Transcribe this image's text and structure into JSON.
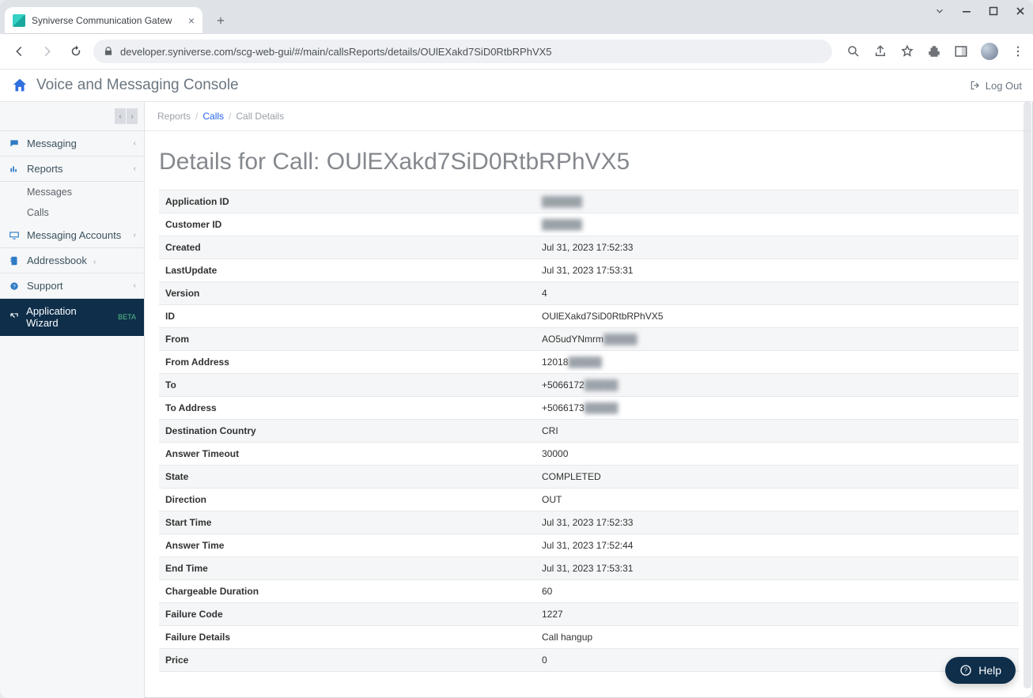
{
  "browser": {
    "tab_title": "Syniverse Communication Gatew",
    "url": "developer.syniverse.com/scg-web-gui/#/main/callsReports/details/OUlEXakd7SiD0RtbRPhVX5"
  },
  "app": {
    "title": "Voice and Messaging Console",
    "logout": "Log Out"
  },
  "sidebar": {
    "pager": {
      "prev": "‹",
      "next": "›"
    },
    "items": [
      {
        "key": "messaging",
        "label": "Messaging"
      },
      {
        "key": "reports",
        "label": "Reports"
      },
      {
        "key": "messaging_accounts",
        "label": "Messaging Accounts"
      },
      {
        "key": "addressbook",
        "label": "Addressbook"
      },
      {
        "key": "support",
        "label": "Support"
      },
      {
        "key": "app_wizard",
        "label": "Application Wizard",
        "badge": "BETA"
      }
    ],
    "reports_sub": [
      {
        "key": "messages",
        "label": "Messages"
      },
      {
        "key": "calls",
        "label": "Calls"
      }
    ]
  },
  "breadcrumb": {
    "root": "Reports",
    "link": "Calls",
    "current": "Call Details"
  },
  "page": {
    "title_prefix": "Details for Call: ",
    "call_id": "OUlEXakd7SiD0RtbRPhVX5"
  },
  "details": [
    {
      "label": "Application ID",
      "value": "██████",
      "blur": true
    },
    {
      "label": "Customer ID",
      "value": "██████",
      "blur": true
    },
    {
      "label": "Created",
      "value": "Jul 31, 2023 17:52:33"
    },
    {
      "label": "LastUpdate",
      "value": "Jul 31, 2023 17:53:31"
    },
    {
      "label": "Version",
      "value": "4"
    },
    {
      "label": "ID",
      "value": "OUlEXakd7SiD0RtbRPhVX5"
    },
    {
      "label": "From",
      "value": "AO5udYNmrm…",
      "blur_partial": true
    },
    {
      "label": "From Address",
      "value": "12018…",
      "blur_partial": true
    },
    {
      "label": "To",
      "value": "+5066172…",
      "blur_partial": true
    },
    {
      "label": "To Address",
      "value": "+5066173…",
      "blur_partial": true
    },
    {
      "label": "Destination Country",
      "value": "CRI"
    },
    {
      "label": "Answer Timeout",
      "value": "30000"
    },
    {
      "label": "State",
      "value": "COMPLETED"
    },
    {
      "label": "Direction",
      "value": "OUT"
    },
    {
      "label": "Start Time",
      "value": "Jul 31, 2023 17:52:33"
    },
    {
      "label": "Answer Time",
      "value": "Jul 31, 2023 17:52:44"
    },
    {
      "label": "End Time",
      "value": "Jul 31, 2023 17:53:31"
    },
    {
      "label": "Chargeable Duration",
      "value": "60"
    },
    {
      "label": "Failure Code",
      "value": "1227"
    },
    {
      "label": "Failure Details",
      "value": "Call hangup"
    },
    {
      "label": "Price",
      "value": "0"
    }
  ],
  "help": {
    "label": "Help"
  }
}
